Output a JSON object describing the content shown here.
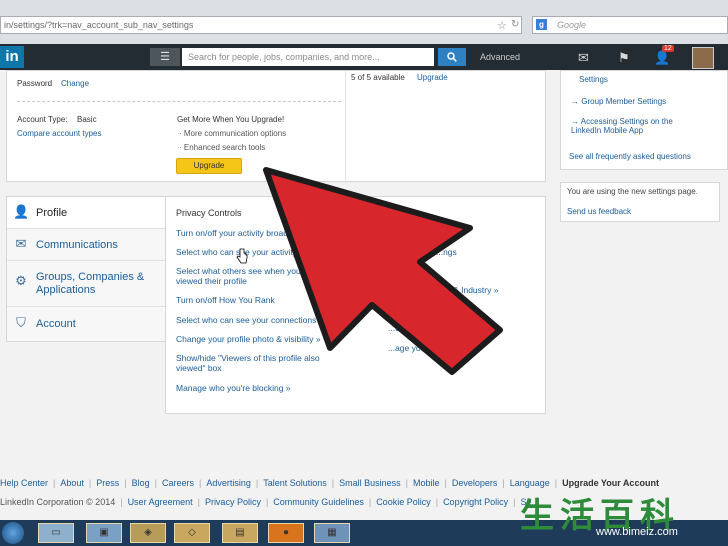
{
  "browser": {
    "url": "in/settings/?trk=nav_account_sub_nav_settings",
    "search_engine_icon": "g-icon",
    "search_placeholder": "Google"
  },
  "nav": {
    "logo": "in",
    "search_placeholder": "Search for people, jobs, companies, and more...",
    "advanced_label": "Advanced",
    "notifications_count": "12"
  },
  "account": {
    "password_label": "Password",
    "password_change": "Change",
    "available_text": "5 of 5 available",
    "available_upgrade": "Upgrade",
    "account_type_label": "Account Type:",
    "account_type_value": "Basic",
    "compare_link": "Compare account types",
    "upgrade_heading": "Get More When You Upgrade!",
    "benefits": [
      "More communication options",
      "Enhanced search tools"
    ],
    "upgrade_button": "Upgrade"
  },
  "right_links": {
    "settings_link": "Settings",
    "group_member_settings": "Group Member Settings",
    "mobile_settings": "Accessing Settings on the LinkedIn Mobile App",
    "all_questions": "See all frequently asked questions",
    "new_settings_text": "You are using the new settings page.",
    "feedback_link": "Send us feedback"
  },
  "sidebar": {
    "items": [
      {
        "label": "Profile",
        "icon": "person-icon"
      },
      {
        "label": "Communications",
        "icon": "envelope-icon"
      },
      {
        "label": "Groups, Companies & Applications",
        "icon": "gear-icon"
      },
      {
        "label": "Account",
        "icon": "shield-icon"
      }
    ]
  },
  "privacy": {
    "heading": "Privacy Controls",
    "links": [
      "Turn on/off your activity broad...",
      "Select who can see your activity...",
      "Select what others see when you've viewed their profile",
      "Turn on/off How You Rank",
      "Select who can see your connections",
      "Change your profile photo & visibility »",
      "Show/hide \"Viewers of this profile also viewed\" box",
      "Manage who you're blocking »"
    ],
    "col2_fragments": [
      "...ngs",
      "...& Industry »",
      "...ur public...",
      "...age your recom..."
    ]
  },
  "footer": {
    "links": [
      "Help Center",
      "About",
      "Press",
      "Blog",
      "Careers",
      "Advertising",
      "Talent Solutions",
      "Small Business",
      "Mobile",
      "Developers",
      "Language",
      "Upgrade Your Account"
    ],
    "copyright": "LinkedIn Corporation © 2014",
    "legal": [
      "User Agreement",
      "Privacy Policy",
      "Community Guidelines",
      "Cookie Policy",
      "Copyright Policy",
      "Se..."
    ]
  },
  "watermark": {
    "chars": "生活百科",
    "url": "www.bimeiz.com"
  },
  "colors": {
    "linkedin_blue": "#0e76a8",
    "nav_dark": "#232c33",
    "upgrade_yellow": "#f5c518",
    "arrow_red": "#d7262c",
    "link_blue": "#1a5d9b"
  }
}
